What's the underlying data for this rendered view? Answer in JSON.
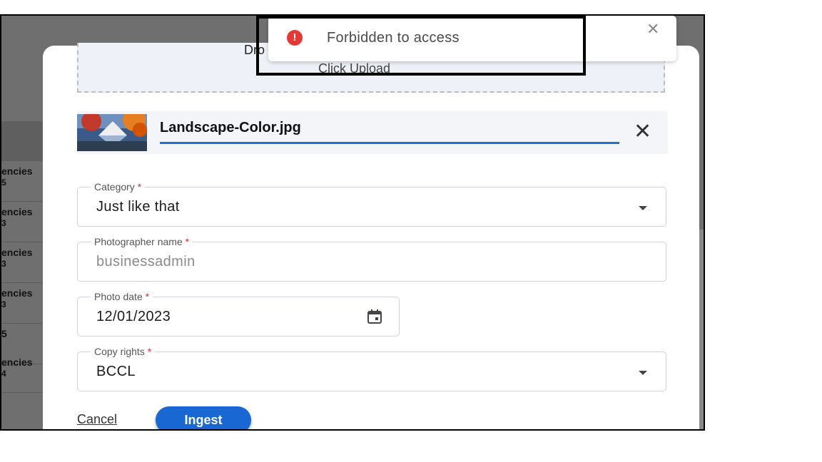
{
  "background_table": {
    "rows": [
      {
        "line1": "encies",
        "line2": "5"
      },
      {
        "line1": "encies",
        "line2": "3"
      },
      {
        "line1": "encies",
        "line2": "3"
      },
      {
        "line1": "encies",
        "line2": "3"
      },
      {
        "line1": "5",
        "line2": ""
      },
      {
        "line1": "encies",
        "line2": "4"
      }
    ]
  },
  "dropzone": {
    "text": "Dro",
    "click_prefix": "Click ",
    "upload_link": "Upload"
  },
  "file": {
    "name": "Landscape-Color.jpg",
    "upload_progress": 1.0
  },
  "form": {
    "category": {
      "label": "Category",
      "required_mark": "*",
      "value": "Just like that"
    },
    "photographer": {
      "label": "Photographer name",
      "required_mark": "*",
      "value": "businessadmin"
    },
    "photo_date": {
      "label": "Photo date",
      "required_mark": "*",
      "value": "12/01/2023"
    },
    "copyrights": {
      "label": "Copy rights",
      "required_mark": "*",
      "value": "BCCL"
    }
  },
  "actions": {
    "cancel": "Cancel",
    "ingest": "Ingest"
  },
  "toast": {
    "icon": "error-icon",
    "icon_glyph": "!",
    "message": "Forbidden to access",
    "close_glyph": "✕"
  },
  "colors": {
    "primary": "#1967d2",
    "error": "#e53935",
    "required": "#d32f2f"
  }
}
